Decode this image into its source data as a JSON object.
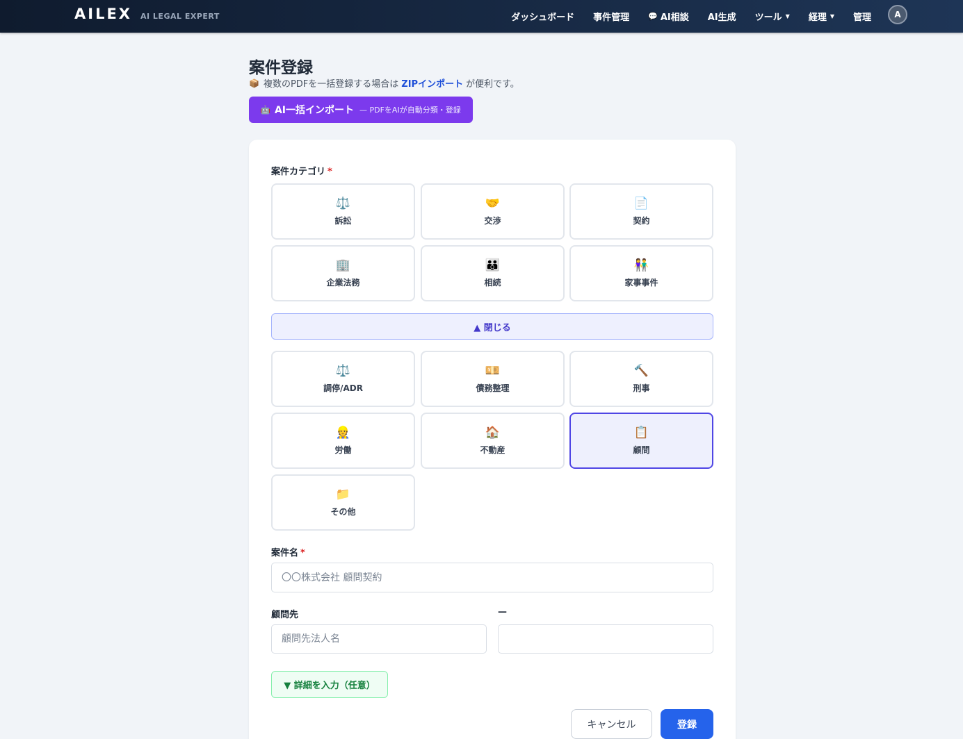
{
  "nav": {
    "logo": "AILEX",
    "tagline": "AI LEGAL EXPERT",
    "links": [
      {
        "label": "ダッシュボード"
      },
      {
        "label": "事件管理"
      },
      {
        "label": "AI相談",
        "icon": "speech-bubble-icon"
      },
      {
        "label": "AI生成"
      },
      {
        "label": "ツール",
        "dropdown": true
      },
      {
        "label": "経理",
        "dropdown": true
      },
      {
        "label": "管理"
      }
    ],
    "avatar_initial": "A"
  },
  "page": {
    "title": "案件登録",
    "note_prefix": "複数のPDFを一括登録する場合は",
    "note_link": "ZIPインポート",
    "note_suffix": "が便利です。",
    "ai_import_label": "AI一括インポート",
    "ai_import_sub": "— PDFをAIが自動分類・登録"
  },
  "form": {
    "category_label": "案件カテゴリ",
    "required_mark": "*",
    "categories_primary": [
      {
        "label": "訴訟",
        "icon": "⚖️",
        "icon_name": "scales-icon"
      },
      {
        "label": "交渉",
        "icon": "🤝",
        "icon_name": "handshake-icon"
      },
      {
        "label": "契約",
        "icon": "📄",
        "icon_name": "document-icon"
      },
      {
        "label": "企業法務",
        "icon": "🏢",
        "icon_name": "office-building-icon"
      },
      {
        "label": "相続",
        "icon": "👪",
        "icon_name": "family-icon"
      },
      {
        "label": "家事事件",
        "icon": "👫",
        "icon_name": "couple-icon"
      }
    ],
    "collapse_label": "▲ 閉じる",
    "categories_more": [
      {
        "label": "調停/ADR",
        "icon": "⚖️",
        "icon_name": "scales-icon"
      },
      {
        "label": "債務整理",
        "icon": "💴",
        "icon_name": "money-icon"
      },
      {
        "label": "刑事",
        "icon": "🔨",
        "icon_name": "hammer-icon"
      },
      {
        "label": "労働",
        "icon": "👷",
        "icon_name": "worker-icon"
      },
      {
        "label": "不動産",
        "icon": "🏠",
        "icon_name": "house-icon"
      },
      {
        "label": "顧問",
        "icon": "📋",
        "icon_name": "clipboard-icon",
        "selected": true
      },
      {
        "label": "その他",
        "icon": "📁",
        "icon_name": "folder-icon"
      }
    ],
    "case_name_label": "案件名",
    "case_name_placeholder": "〇〇株式会社 顧問契約",
    "client_label": "顧問先",
    "client_placeholder": "顧問先法人名",
    "second_label": "—",
    "second_value": "",
    "detail_toggle": "▼ 詳細を入力（任意）",
    "cancel_label": "キャンセル",
    "submit_label": "登録"
  },
  "colors": {
    "nav_bg": "#0f1b2e",
    "accent_purple": "#7c3aed",
    "primary_blue": "#2563eb",
    "selected_border": "#4f46e5",
    "required_red": "#dc2626"
  }
}
